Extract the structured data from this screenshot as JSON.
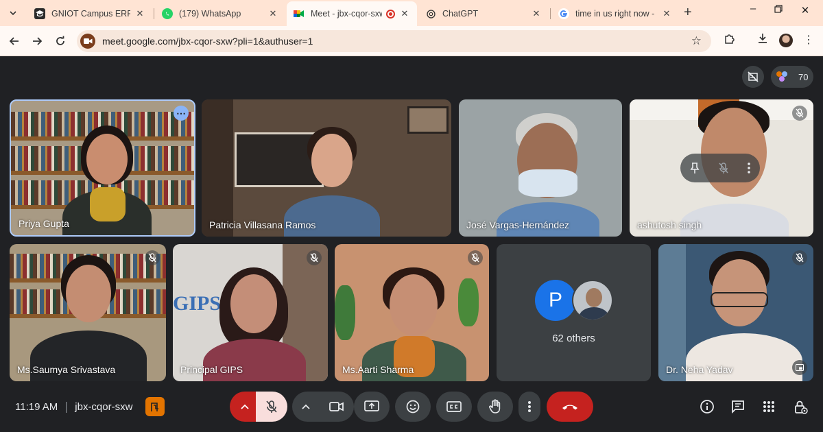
{
  "browser": {
    "tabs": [
      {
        "title": "GNIOT Campus ERP",
        "icon": "graduation-cap-icon"
      },
      {
        "title": "(179) WhatsApp",
        "icon": "whatsapp-icon"
      },
      {
        "title": "Meet - jbx-cqor-sxw",
        "icon": "google-meet-icon",
        "active": true
      },
      {
        "title": "ChatGPT",
        "icon": "chatgpt-icon"
      },
      {
        "title": "time in us right now - Go",
        "icon": "google-icon"
      }
    ],
    "url": "meet.google.com/jbx-cqor-sxw?pli=1&authuser=1"
  },
  "meet": {
    "participant_count": "70",
    "participants": [
      {
        "name": "Priya Gupta",
        "speaking": true
      },
      {
        "name": "Patricia Villasana Ramos"
      },
      {
        "name": "José Vargas-Hernández"
      },
      {
        "name": "ashutosh singh",
        "muted": true
      },
      {
        "name": "Ms.Saumya Srivastava",
        "muted": true
      },
      {
        "name": "Principal GIPS",
        "muted": true
      },
      {
        "name": "Ms.Aarti Sharma",
        "muted": true
      },
      {
        "name": "Dr. Neha Yadav",
        "muted": true
      }
    ],
    "others": {
      "avatar_letter": "P",
      "label": "62 others"
    },
    "wall_text": "GIPS",
    "time": "11:19 AM",
    "meeting_code": "jbx-cqor-sxw"
  },
  "colors": {
    "accent": "#8ab4f8",
    "end_call": "#c5221f",
    "tab_bar": "#ffe4d4"
  }
}
